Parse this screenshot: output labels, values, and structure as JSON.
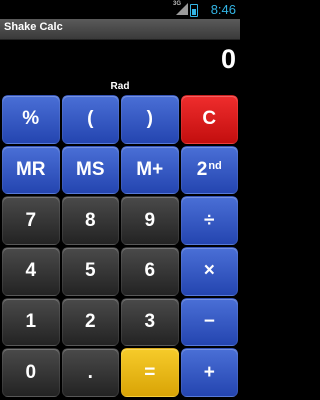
{
  "status_bar": {
    "time": "8:46",
    "network": "3G"
  },
  "app": {
    "title": "Shake Calc"
  },
  "display": {
    "value": "0",
    "mode": "Rad"
  },
  "keys": [
    {
      "label": "%",
      "style": "blue"
    },
    {
      "label": "(",
      "style": "blue"
    },
    {
      "label": ")",
      "style": "blue"
    },
    {
      "label": "C",
      "style": "red"
    },
    {
      "label": "MR",
      "style": "blue"
    },
    {
      "label": "MS",
      "style": "blue"
    },
    {
      "label": "M+",
      "style": "blue"
    },
    {
      "label": "2",
      "superscript": "nd",
      "style": "blue"
    },
    {
      "label": "7",
      "style": "dark"
    },
    {
      "label": "8",
      "style": "dark"
    },
    {
      "label": "9",
      "style": "dark"
    },
    {
      "label": "÷",
      "style": "blue"
    },
    {
      "label": "4",
      "style": "dark"
    },
    {
      "label": "5",
      "style": "dark"
    },
    {
      "label": "6",
      "style": "dark"
    },
    {
      "label": "×",
      "style": "blue"
    },
    {
      "label": "1",
      "style": "dark"
    },
    {
      "label": "2",
      "style": "dark"
    },
    {
      "label": "3",
      "style": "dark"
    },
    {
      "label": "−",
      "style": "blue"
    },
    {
      "label": "0",
      "style": "dark"
    },
    {
      "label": ".",
      "style": "dark"
    },
    {
      "label": "=",
      "style": "yellow"
    },
    {
      "label": "+",
      "style": "blue"
    }
  ]
}
